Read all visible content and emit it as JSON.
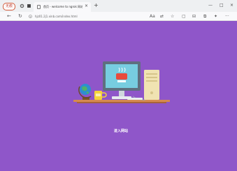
{
  "browser": {
    "profile_label": "无痕",
    "tab_title": "首页 - welcome to ngrok 网站",
    "tab_close": "×",
    "new_tab": "+",
    "url": "hjz01.2j1.xinb.com/index.html",
    "window_controls": [
      "—",
      "□",
      "×"
    ],
    "zoom_hint": "Aa"
  },
  "page": {
    "background": "#8f56c9",
    "enter_label": "进入网站"
  }
}
